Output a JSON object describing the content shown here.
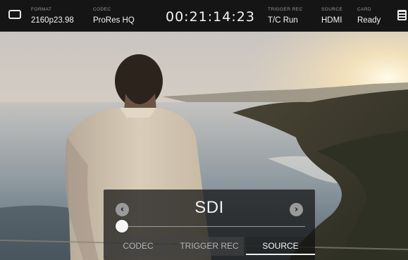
{
  "status_bar": {
    "format_label": "FORMAT",
    "format_value": "2160p23.98",
    "codec_label": "CODEC",
    "codec_value": "ProRes HQ",
    "timecode": "00:21:14:23",
    "trigger_label": "TRIGGER REC",
    "trigger_value": "T/C Run",
    "source_label": "SOURCE",
    "source_value": "HDMI",
    "card_label": "CARD",
    "card_value": "Ready",
    "monitor_icon": "monitor-icon",
    "menu_icon": "menu-grid-icon"
  },
  "selector": {
    "current_value": "SDI",
    "prev_icon": "chevron-left-icon",
    "next_icon": "chevron-right-icon",
    "prev_glyph": "‹",
    "next_glyph": "›",
    "tabs": [
      {
        "label": "CODEC",
        "active": false
      },
      {
        "label": "TRIGGER REC",
        "active": false
      },
      {
        "label": "SOURCE",
        "active": true
      }
    ]
  },
  "colors": {
    "bar_background": "#151515",
    "accent": "#f0f0f0"
  }
}
